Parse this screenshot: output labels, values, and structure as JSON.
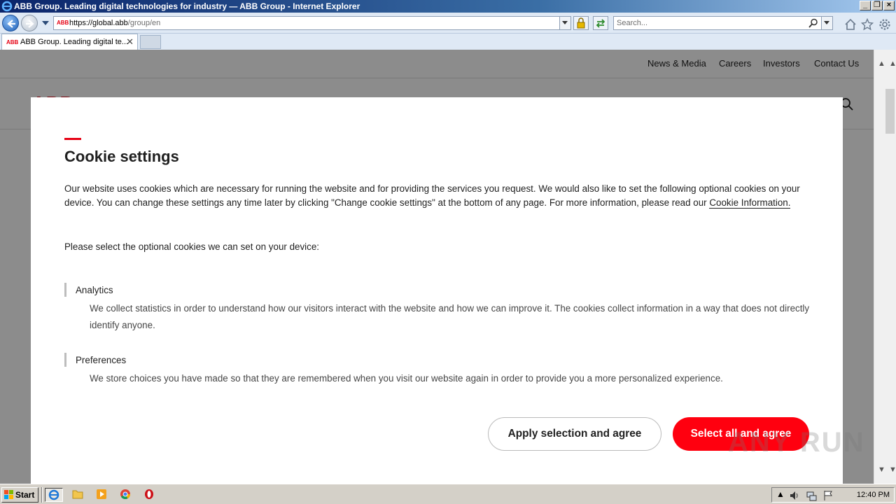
{
  "window": {
    "title": "ABB Group. Leading digital technologies for industry — ABB Group - Internet Explorer",
    "min_icon": "minimize-icon",
    "max_icon": "restore-icon",
    "close_icon": "close-icon"
  },
  "browser": {
    "address_host": "https://global.abb",
    "address_path": "/group/en",
    "search_placeholder": "Search...",
    "tab_label": "ABB Group. Leading digital te...",
    "tab_close": "✕",
    "favicon_text": "ABB"
  },
  "site": {
    "logo": "ABB",
    "topnav": [
      "News & Media",
      "Careers",
      "Investors",
      "Contact Us"
    ]
  },
  "cookie_dialog": {
    "title": "Cookie settings",
    "intro": "Our website uses cookies which are necessary for running the website and for providing the services you request. We would also like to set the following optional cookies on your device. You can change these settings any time later by clicking \"Change cookie settings\" at the bottom of any page. For more information, please read our ",
    "info_link": "Cookie Information.",
    "select_prompt": "Please select the optional cookies we can set on your device:",
    "categories": [
      {
        "title": "Analytics",
        "desc": "We collect statistics in order to understand how our visitors interact with the website and how we can improve it. The cookies collect information in a way that does not directly identify anyone."
      },
      {
        "title": "Preferences",
        "desc": "We store choices you have made so that they are remembered when you visit our website again in order to provide you a more personalized experience."
      }
    ],
    "apply_button": "Apply selection and agree",
    "select_all_button": "Select all and agree"
  },
  "watermark": "ANY RUN",
  "taskbar": {
    "start_label": "Start",
    "clock": "12:40 PM"
  },
  "colors": {
    "accent": "#e60012",
    "button_red": "#ff000f"
  }
}
